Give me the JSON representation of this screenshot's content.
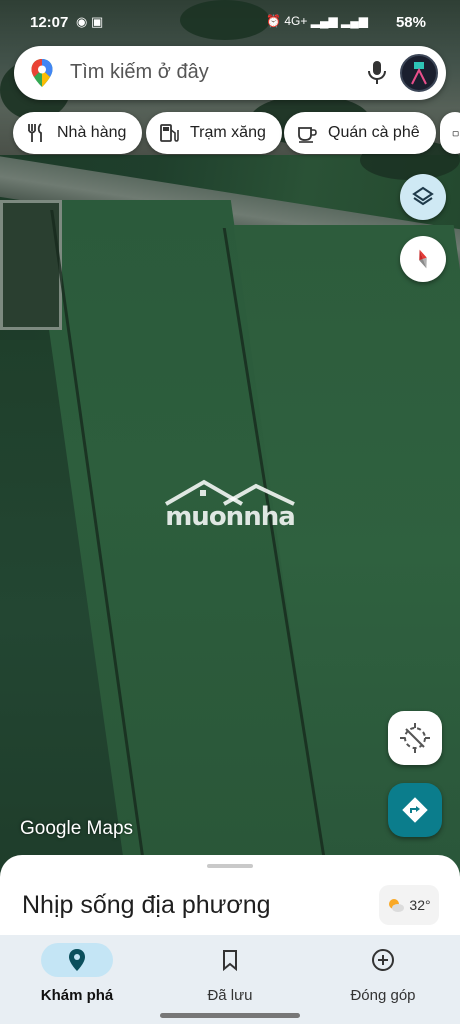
{
  "status_bar": {
    "time": "12:07",
    "battery": "58%",
    "network": "4G+"
  },
  "search": {
    "placeholder": "Tìm kiếm ở đây"
  },
  "chips": [
    {
      "label": "Nhà hàng",
      "icon": "restaurant-icon"
    },
    {
      "label": "Trạm xăng",
      "icon": "gas-station-icon"
    },
    {
      "label": "Quán cà phê",
      "icon": "coffee-icon"
    }
  ],
  "map": {
    "watermark": "muonnha",
    "attribution": "Google Maps"
  },
  "sheet": {
    "title": "Nhịp sống địa phương",
    "temperature": "32°"
  },
  "bottom_nav": [
    {
      "label": "Khám phá",
      "icon": "explore-pin-icon",
      "active": true
    },
    {
      "label": "Đã lưu",
      "icon": "bookmark-icon",
      "active": false
    },
    {
      "label": "Đóng góp",
      "icon": "add-circle-icon",
      "active": false
    }
  ],
  "colors": {
    "accent": "#0b7d8c",
    "active_nav_bg": "#c4e5f5",
    "layers_bg": "#cfe9f4"
  }
}
